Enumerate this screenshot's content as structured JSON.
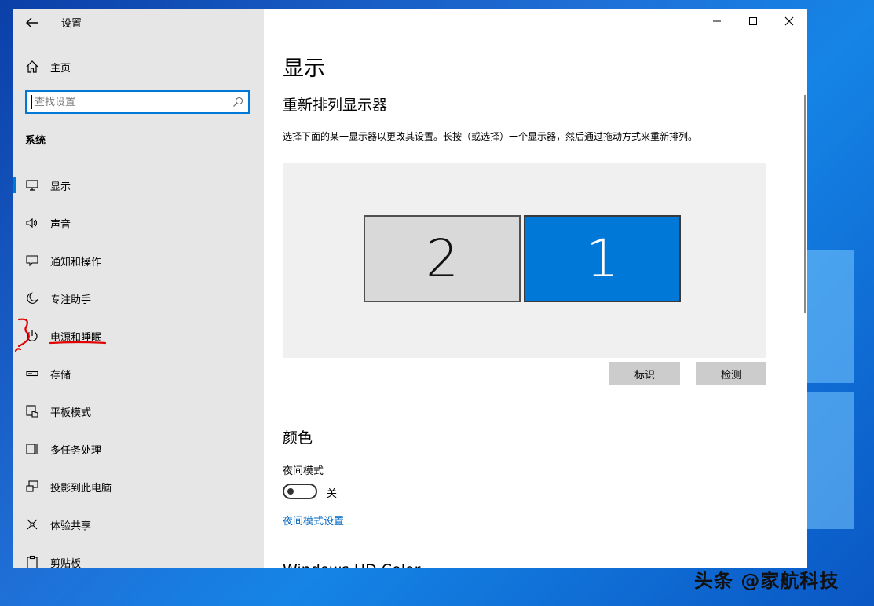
{
  "window": {
    "title": "设置",
    "controls": {
      "minimize": "minimize-icon",
      "maximize": "maximize-icon",
      "close": "close-icon"
    }
  },
  "sidebar": {
    "home_label": "主页",
    "search_placeholder": "查找设置",
    "section_label": "系统",
    "items": [
      {
        "label": "显示",
        "icon": "monitor-icon",
        "active": true
      },
      {
        "label": "声音",
        "icon": "speaker-icon"
      },
      {
        "label": "通知和操作",
        "icon": "notification-icon"
      },
      {
        "label": "专注助手",
        "icon": "moon-icon"
      },
      {
        "label": "电源和睡眠",
        "icon": "power-icon"
      },
      {
        "label": "存储",
        "icon": "storage-icon"
      },
      {
        "label": "平板模式",
        "icon": "tablet-mode-icon"
      },
      {
        "label": "多任务处理",
        "icon": "multitasking-icon"
      },
      {
        "label": "投影到此电脑",
        "icon": "project-icon"
      },
      {
        "label": "体验共享",
        "icon": "share-icon"
      },
      {
        "label": "剪贴板",
        "icon": "clipboard-icon"
      }
    ]
  },
  "main": {
    "page_title": "显示",
    "rearrange_heading": "重新排列显示器",
    "rearrange_desc": "选择下面的某一显示器以更改其设置。长按（或选择）一个显示器，然后通过拖动方式来重新排列。",
    "monitors": [
      {
        "number": "2",
        "selected": false
      },
      {
        "number": "1",
        "selected": true
      }
    ],
    "identify_button": "标识",
    "detect_button": "检测",
    "color_heading": "颜色",
    "night_light_label": "夜间模式",
    "night_light_state": "关",
    "night_light_link": "夜间模式设置",
    "cut_off_heading": "Windows HD Color"
  },
  "colors": {
    "accent": "#0078d7",
    "link": "#0067c0",
    "sidebar_bg": "#e6e6e6",
    "annotation": "#e00000"
  },
  "watermark": "头条 @家航科技"
}
